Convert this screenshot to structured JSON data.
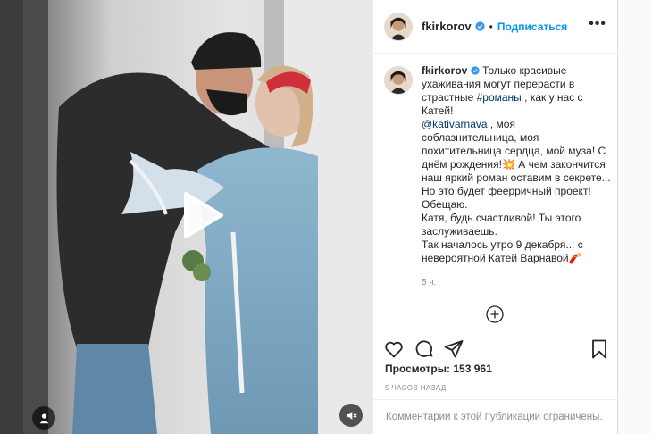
{
  "header": {
    "username": "fkirkorov",
    "separator": "•",
    "follow_label": "Подписаться",
    "more_label": "•••"
  },
  "caption": {
    "username": "fkirkorov",
    "line1_before": "Только красивые ухаживания могут перерасти в страстные ",
    "hashtag": "#романы",
    "line1_after": " , как у нас с Катей!",
    "mention": "@kativarnava",
    "line2": " , моя соблазнительница, моя похитительница сердца, мой муза! С днём рождения!💥 А чем закончится наш яркий роман оставим в секрете... Но это будет феерричный проект! Обещаю.",
    "line3": "Катя, будь счастливой! Ты этого заслуживаешь.",
    "line4": "Так началось утро 9 декабря... с невероятной Катей Варнавой🧨",
    "time_ago": "5 ч."
  },
  "stats": {
    "views_label": "Просмотры:",
    "views_count": "153 961",
    "posted": "5 ЧАСОВ НАЗАД"
  },
  "comments": {
    "disabled_text": "Комментарии к этой публикации ограничены."
  },
  "icons": {
    "verified": "verified-badge-icon",
    "play": "play-icon",
    "profile": "user-tag-icon",
    "mute": "volume-muted-icon",
    "like": "heart-icon",
    "comment": "comment-icon",
    "share": "paper-plane-icon",
    "save": "bookmark-icon",
    "load_more": "plus-circle-icon"
  },
  "colors": {
    "accent": "#0095f6",
    "verified": "#3897f0",
    "muted_text": "#8e8e8e",
    "text": "#262626"
  }
}
